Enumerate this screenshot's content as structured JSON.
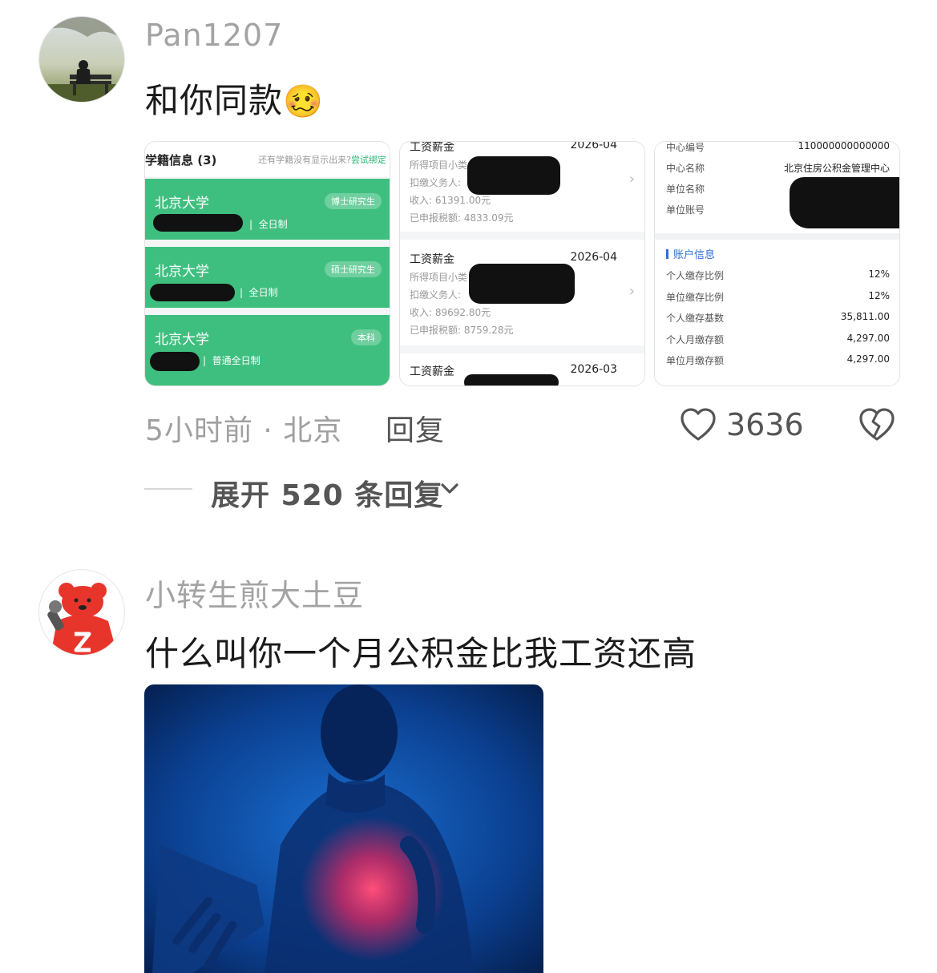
{
  "comments": [
    {
      "username": "Pan1207",
      "text": "和你同款",
      "emoji": "🥴",
      "meta": "5小时前 · 北京",
      "reply_label": "回复",
      "like_count": "3636",
      "expand_label": "展开 520 条回复",
      "attachments": {
        "school": {
          "title": "学籍信息 (3)",
          "hint": "还有学籍没有显示出来?",
          "hint_link": "尝试绑定",
          "entries": [
            {
              "school": "北京大学",
              "degree": "博士研究生",
              "mode": "全日制"
            },
            {
              "school": "北京大学",
              "degree": "硕士研究生",
              "mode": "全日制"
            },
            {
              "school": "北京大学",
              "degree": "本科",
              "mode": "普通全日制"
            }
          ]
        },
        "salary": {
          "entries": [
            {
              "title": "工资薪金",
              "date": "2026-04",
              "item_label": "所得项目小类",
              "payer_label": "扣缴义务人:",
              "income": "收入: 61391.00元",
              "tax": "已申报税额: 4833.09元"
            },
            {
              "title": "工资薪金",
              "date": "2026-04",
              "item_label": "所得项目小类",
              "payer_label": "扣缴义务人:",
              "income": "收入: 89692.80元",
              "tax": "已申报税额: 8759.28元"
            },
            {
              "title": "工资薪金",
              "date": "2026-03"
            }
          ]
        },
        "fund": {
          "top_rows": [
            {
              "label": "中心编号",
              "value": "110000000000000"
            },
            {
              "label": "中心名称",
              "value": "北京住房公积金管理中心"
            },
            {
              "label": "单位名称",
              "value": ""
            },
            {
              "label": "单位账号",
              "value": ""
            }
          ],
          "section_title": "账户信息",
          "rows": [
            {
              "label": "个人缴存比例",
              "value": "12%"
            },
            {
              "label": "单位缴存比例",
              "value": "12%"
            },
            {
              "label": "个人缴存基数",
              "value": "35,811.00"
            },
            {
              "label": "个人月缴存额",
              "value": "4,297.00"
            },
            {
              "label": "单位月缴存额",
              "value": "4,297.00"
            }
          ]
        }
      }
    },
    {
      "username": "小转生煎大土豆",
      "text": "什么叫你一个月公积金比我工资还高"
    }
  ],
  "colors": {
    "green": "#3fbf7f",
    "link": "#2bb673",
    "accent_blue": "#2f6fd6",
    "username": "#a3a3a3"
  },
  "icons": [
    "heart-icon",
    "broken-heart-icon",
    "chevron-down-icon",
    "chevron-right-icon"
  ]
}
